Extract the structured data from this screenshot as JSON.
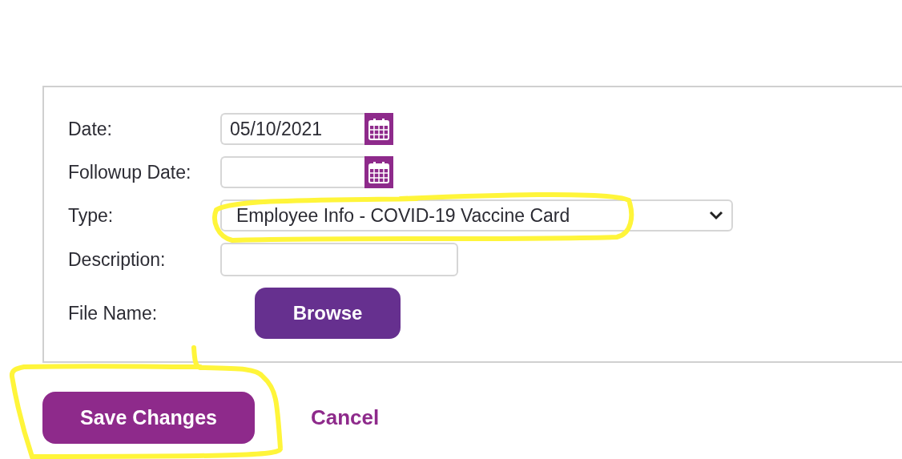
{
  "form": {
    "fields": [
      {
        "kind": "date",
        "label": "Date:",
        "value": "05/10/2021"
      },
      {
        "kind": "date",
        "label": "Followup Date:"
      },
      {
        "kind": "select",
        "label": "Type:",
        "value": "Employee Info - COVID-19 Vaccine Card"
      },
      {
        "kind": "text",
        "label": "Description:"
      },
      {
        "kind": "file",
        "label": "File Name:",
        "button": "Browse"
      }
    ]
  },
  "actions": {
    "save": "Save Changes",
    "cancel": "Cancel"
  }
}
